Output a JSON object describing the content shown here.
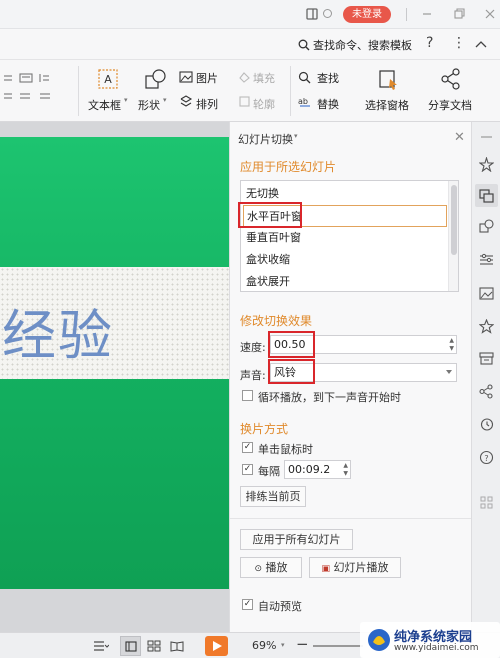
{
  "titlebar": {
    "login_label": "未登录"
  },
  "cmdbar": {
    "search_label": "查找命令、搜索模板",
    "help_label": "?",
    "more_label": "⋮"
  },
  "ribbon": {
    "textbox_label": "文本框",
    "shape_label": "形状",
    "picture_label": "图片",
    "arrange_label": "排列",
    "fill_label": "填充",
    "outline_label": "轮廓",
    "find_label": "查找",
    "replace_label": "替换",
    "select_pane_label": "选择窗格",
    "share_label": "分享文档"
  },
  "slide": {
    "text": "经验"
  },
  "panel": {
    "title": "幻灯片切换",
    "section_apply": "应用于所选幻灯片",
    "transitions": [
      "无切换",
      "水平百叶窗",
      "垂直百叶窗",
      "盒状收缩",
      "盒状展开"
    ],
    "selected_transition": "水平百叶窗",
    "section_modify": "修改切换效果",
    "speed_label": "速度:",
    "speed_value": "00.50",
    "sound_label": "声音:",
    "sound_value": "风铃",
    "loop_label": "循环播放，到下一声音开始时",
    "section_advance": "换片方式",
    "on_click_label": "单击鼠标时",
    "every_label": "每隔",
    "every_value": "00:09.2",
    "rehearse_label": "排练当前页",
    "apply_all_label": "应用于所有幻灯片",
    "play_label": "播放",
    "slideshow_label": "幻灯片播放",
    "autopreview_label": "自动预览"
  },
  "statusbar": {
    "zoom": "69%"
  },
  "watermark": {
    "title": "纯净系统家园",
    "url": "www.yidaimei.com"
  },
  "colors": {
    "accent": "#e08a2c",
    "highlight": "#d9262b",
    "slide_green": "#13b060",
    "play": "#f0792a"
  }
}
